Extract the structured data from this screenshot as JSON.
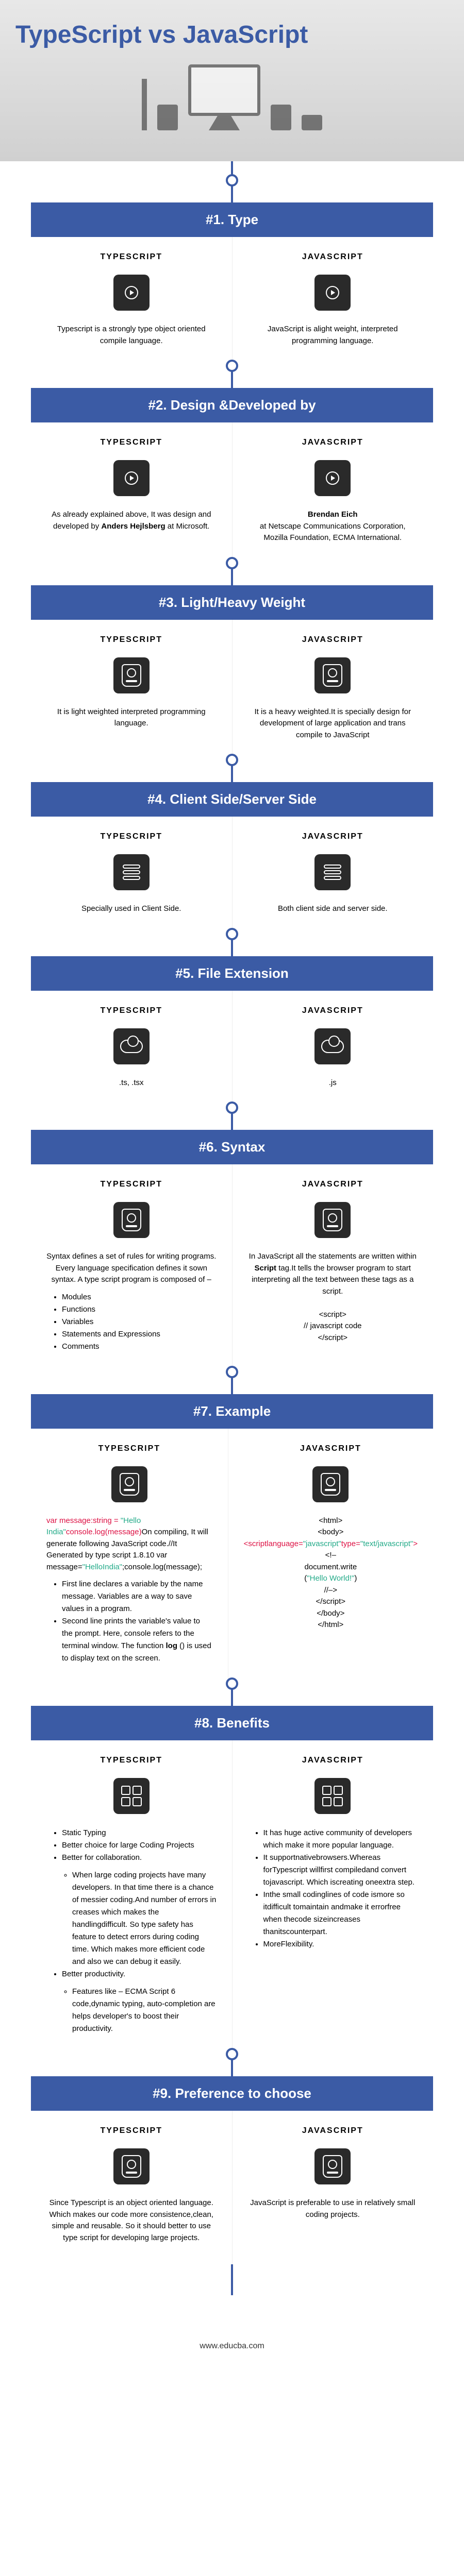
{
  "title": "TypeScript vs JavaScript",
  "col_ts": "TYPESCRIPT",
  "col_js": "JAVASCRIPT",
  "sections": [
    {
      "header": "#1. Type",
      "icon": "play",
      "ts": "Typescript is a strongly type object oriented compile language.",
      "js": "JavaScript is alight weight, interpreted programming language."
    },
    {
      "header": "#2. Design &Developed by",
      "icon": "play",
      "ts_html": "As already explained above, It was design and developed by <b>Anders Hejlsberg</b> at Microsoft.",
      "js_html": "<b>Brendan Eich</b><br>at Netscape Communications Corporation, Mozilla Foundation, ECMA International."
    },
    {
      "header": "#3. Light/Heavy Weight",
      "icon": "disk",
      "ts": "It is light weighted interpreted programming language.",
      "js": "It is a heavy weighted.It is specially design for development of large application and trans compile to JavaScript"
    },
    {
      "header": "#4. Client Side/Server Side",
      "icon": "stack",
      "ts": "Specially used in Client Side.",
      "js": "Both client side and server side."
    },
    {
      "header": "#5. File Extension",
      "icon": "cloud",
      "ts": ".ts, .tsx",
      "js": ".js"
    },
    {
      "header": "#6. Syntax",
      "icon": "disk",
      "ts_html": "Syntax defines a set of rules for writing programs. Every language specification defines it sown syntax. A type script program is composed of –<ul><li>Modules</li><li>Functions</li><li>Variables</li><li>Statements and Expressions</li><li>Comments</li></ul>",
      "js_html": "In JavaScript all the statements are written within <b>Script</b> tag.It tells the browser program to start interpreting all the text between these tags as a script.<br><br>&lt;script&gt;<br>// javascript code<br>&lt;/script&gt;"
    },
    {
      "header": "#7. Example",
      "icon": "disk",
      "ts_html": "<div class='desc-left'><span class='code-red'>var message:string = </span><span class='code-green'>\"Hello India\"</span><span class='code-red'>console.log(message)</span>On compiling, It will generate following JavaScript code.//It Generated by type script 1.8.10 var message=<span class='code-green'>\"HelloIndia\"</span>;console.log(message);<ul><li>First line declares a variable by the name message. Variables are a way to save values in a program.</li><li>Second line prints the variable's value to the prompt. Here, console refers to the terminal window. The function <b>log</b> () is used to display text on the screen.</li></ul></div>",
      "js_html": "<div style='text-align:center'>&lt;html&gt;<br>&lt;body&gt;<br><span class='code-red'>&lt;scriptlanguage=</span><span class='code-green'>\"javascript\"</span><span class='code-red'>type=</span><span class='code-green'>\"text/javascript\"</span><span class='code-red'>&gt;</span><br>&lt;!–<br>document.write<br>(<span class='code-green'>\"Hello World!\"</span>)<br>//–&gt;<br>&lt;/script&gt;<br>&lt;/body&gt;<br>&lt;/html&gt;</div>"
    },
    {
      "header": "#8. Benefits",
      "icon": "grid",
      "ts_html": "<ul><li>Static Typing</li><li>Better choice for large Coding Projects</li><li>Better for collaboration.<ul class='sub-ul'><li>When large coding projects have many developers. In that time there is a chance of messier coding.And number of errors in creases which makes the handlingdifficult. So type safety has feature to detect errors during coding time. Which makes more efficient code and also we can debug it easily.</li></ul></li><li>Better productivity.<ul class='sub-ul'><li>Features like – ECMA Script 6 code,dynamic typing, auto-completion are helps developer's to boost their productivity.</li></ul></li></ul>",
      "js_html": "<ul><li>It has huge active community of developers which make it more popular language.</li><li>It supportnativebrowsers.Whereas forTypescript willfirst compiledand convert tojavascript. Which iscreating oneextra step.</li><li>Inthe small codinglines of code ismore so itdifficult tomaintain andmake it errorfree when thecode sizeincreases thanitscounterpart.</li><li>MoreFlexibility.</li></ul>"
    },
    {
      "header": "#9. Preference to choose",
      "icon": "disk",
      "ts": "Since Typescript is an object oriented language. Which makes our code more consistence,clean, simple and reusable. So it should better to use type script for developing large projects.",
      "js": "JavaScript is preferable to use in relatively small coding projects."
    }
  ],
  "footer": "www.educba.com"
}
